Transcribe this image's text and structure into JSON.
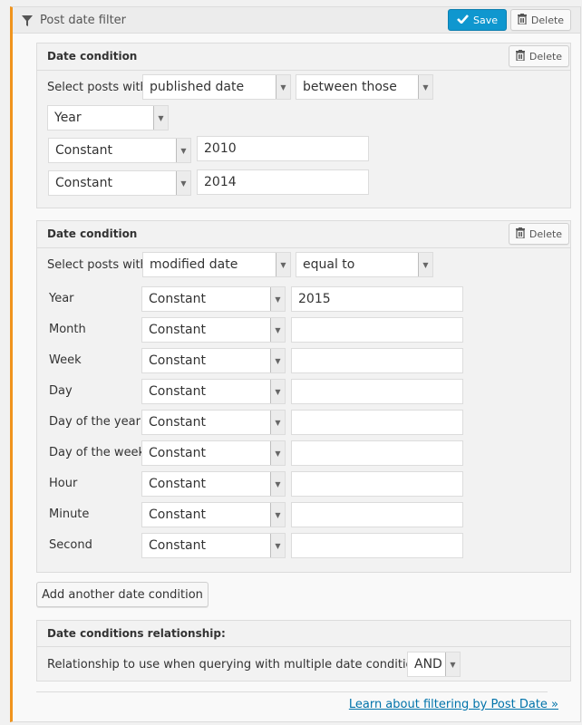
{
  "header": {
    "title": "Post date filter",
    "icon": "filter-icon",
    "save_label": "Save",
    "delete_label": "Delete"
  },
  "conditions": [
    {
      "title": "Date condition",
      "delete_label": "Delete",
      "select_posts_label": "Select posts with",
      "date_field": "published date",
      "comparison": "between those",
      "unit": "Year",
      "rows": [
        {
          "type": "Constant",
          "value": "2010"
        },
        {
          "type": "Constant",
          "value": "2014"
        }
      ]
    },
    {
      "title": "Date condition",
      "delete_label": "Delete",
      "select_posts_label": "Select posts with",
      "date_field": "modified date",
      "comparison": "equal to",
      "rows": [
        {
          "label": "Year",
          "type": "Constant",
          "value": "2015"
        },
        {
          "label": "Month",
          "type": "Constant",
          "value": ""
        },
        {
          "label": "Week",
          "type": "Constant",
          "value": ""
        },
        {
          "label": "Day",
          "type": "Constant",
          "value": ""
        },
        {
          "label": "Day of the year",
          "type": "Constant",
          "value": ""
        },
        {
          "label": "Day of the week",
          "type": "Constant",
          "value": ""
        },
        {
          "label": "Hour",
          "type": "Constant",
          "value": ""
        },
        {
          "label": "Minute",
          "type": "Constant",
          "value": ""
        },
        {
          "label": "Second",
          "type": "Constant",
          "value": ""
        }
      ]
    }
  ],
  "add_condition_label": "Add another date condition",
  "relationship": {
    "title": "Date conditions relationship:",
    "label": "Relationship to use when querying with multiple date conditions:",
    "value": "AND"
  },
  "learn_link": "Learn about filtering by Post Date »",
  "colors": {
    "accent": "#f0941d",
    "save_button": "#0f97cf",
    "link": "#0073aa"
  }
}
